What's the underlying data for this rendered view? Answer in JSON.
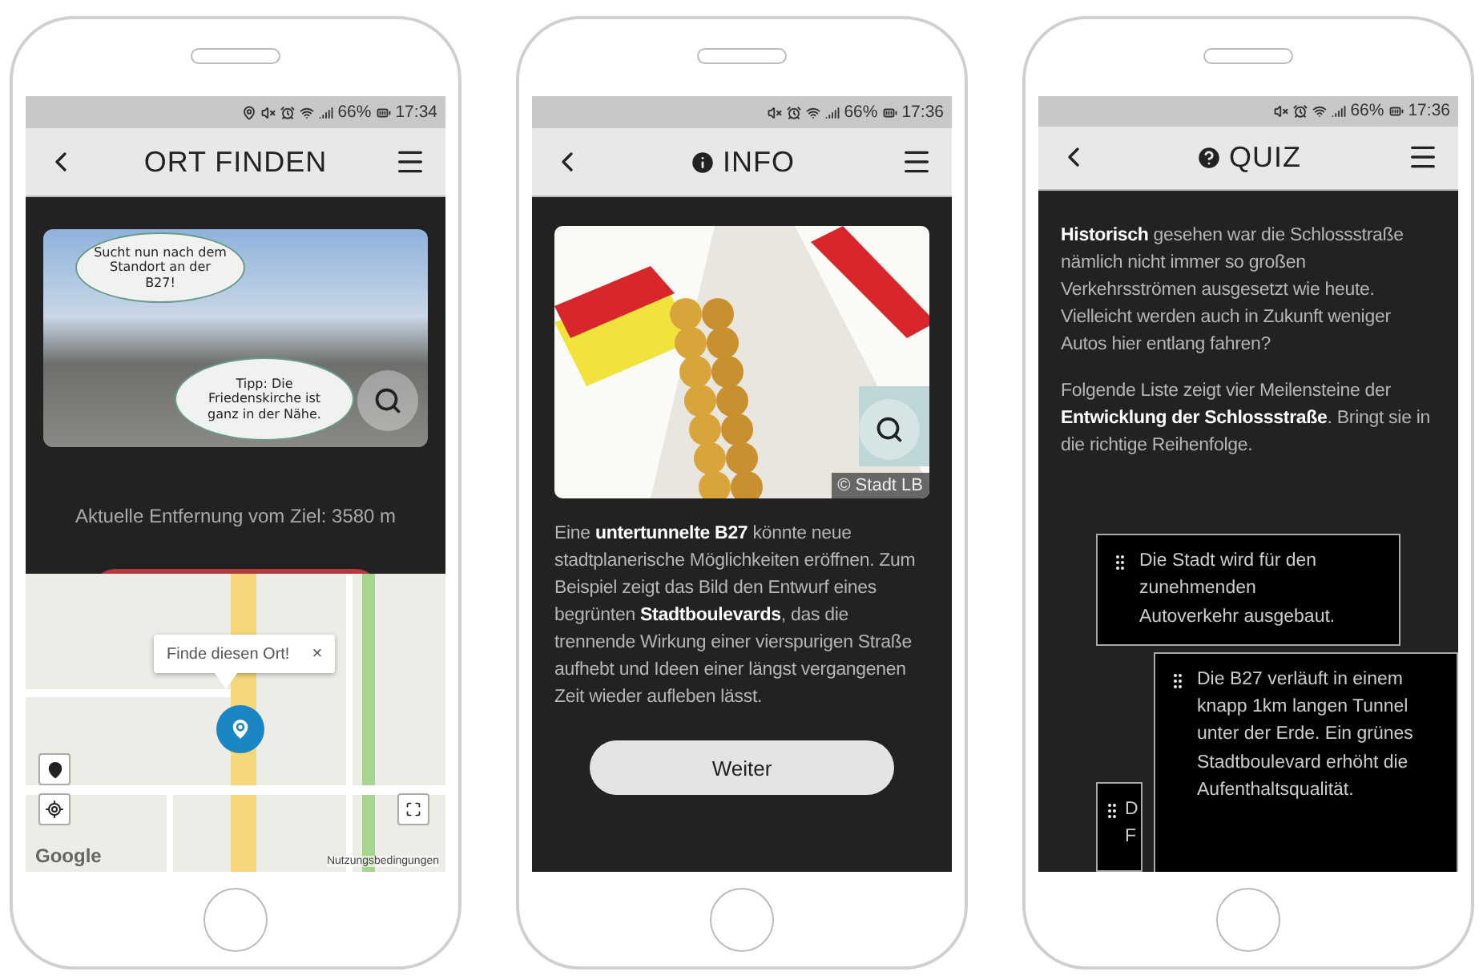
{
  "screens": [
    {
      "kind": "find",
      "status_bar": {
        "battery": "66%",
        "time": "17:34"
      },
      "header": {
        "title": "ORT FINDEN"
      },
      "photo": {
        "bubbles": [
          "Sucht nun nach dem Standort an der B27!",
          "Tipp: Die Friedenskirche ist ganz in der Nähe."
        ]
      },
      "distance": "Aktuelle Entfernung vom Ziel: 3580 m",
      "map": {
        "popup": "Finde diesen Ort!",
        "popup_close": "×",
        "logo": "Google",
        "terms": "Nutzungsbedingungen"
      }
    },
    {
      "kind": "info",
      "status_bar": {
        "battery": "66%",
        "time": "17:36"
      },
      "header": {
        "title": "INFO"
      },
      "image": {
        "credit": "© Stadt LB"
      },
      "text": "Eine **untertunnelte B27** könnte neue stadtplanerische Möglichkeiten eröffnen. Zum Beispiel zeigt das Bild den Entwurf eines begrünten **Stadtboulevards**, das die trennende Wirkung einer vierspurigen Straße aufhebt und Ideen einer längst vergangenen Zeit wieder aufleben lässt.",
      "button": "Weiter"
    },
    {
      "kind": "quiz",
      "status_bar": {
        "battery": "66%",
        "time": "17:36"
      },
      "header": {
        "title": "QUIZ"
      },
      "paragraphs": [
        "**Historisch** gesehen war die Schlossstraße nämlich nicht immer so großen Verkehrsströmen ausgesetzt wie heute. Vielleicht werden auch in Zukunft weniger Autos hier entlang fahren?",
        "Folgende Liste zeigt vier Meilensteine der **Entwicklung der Schlossstraße**. Bringt sie in die richtige Reihenfolge."
      ],
      "cards": [
        {
          "kind": "placed",
          "lines": [
            "Die Stadt wird für den",
            "zunehmenden",
            "Autoverkehr ausgebaut."
          ]
        },
        {
          "kind": "placed",
          "lines": [
            "D",
            "F"
          ]
        },
        {
          "kind": "dragging",
          "lines": [
            "Die B27 verläuft in einem knapp 1km langen Tunnel unter der Erde. Ein grünes Stadtboulevard erhöht die Aufenthaltsqualität."
          ]
        }
      ]
    }
  ]
}
